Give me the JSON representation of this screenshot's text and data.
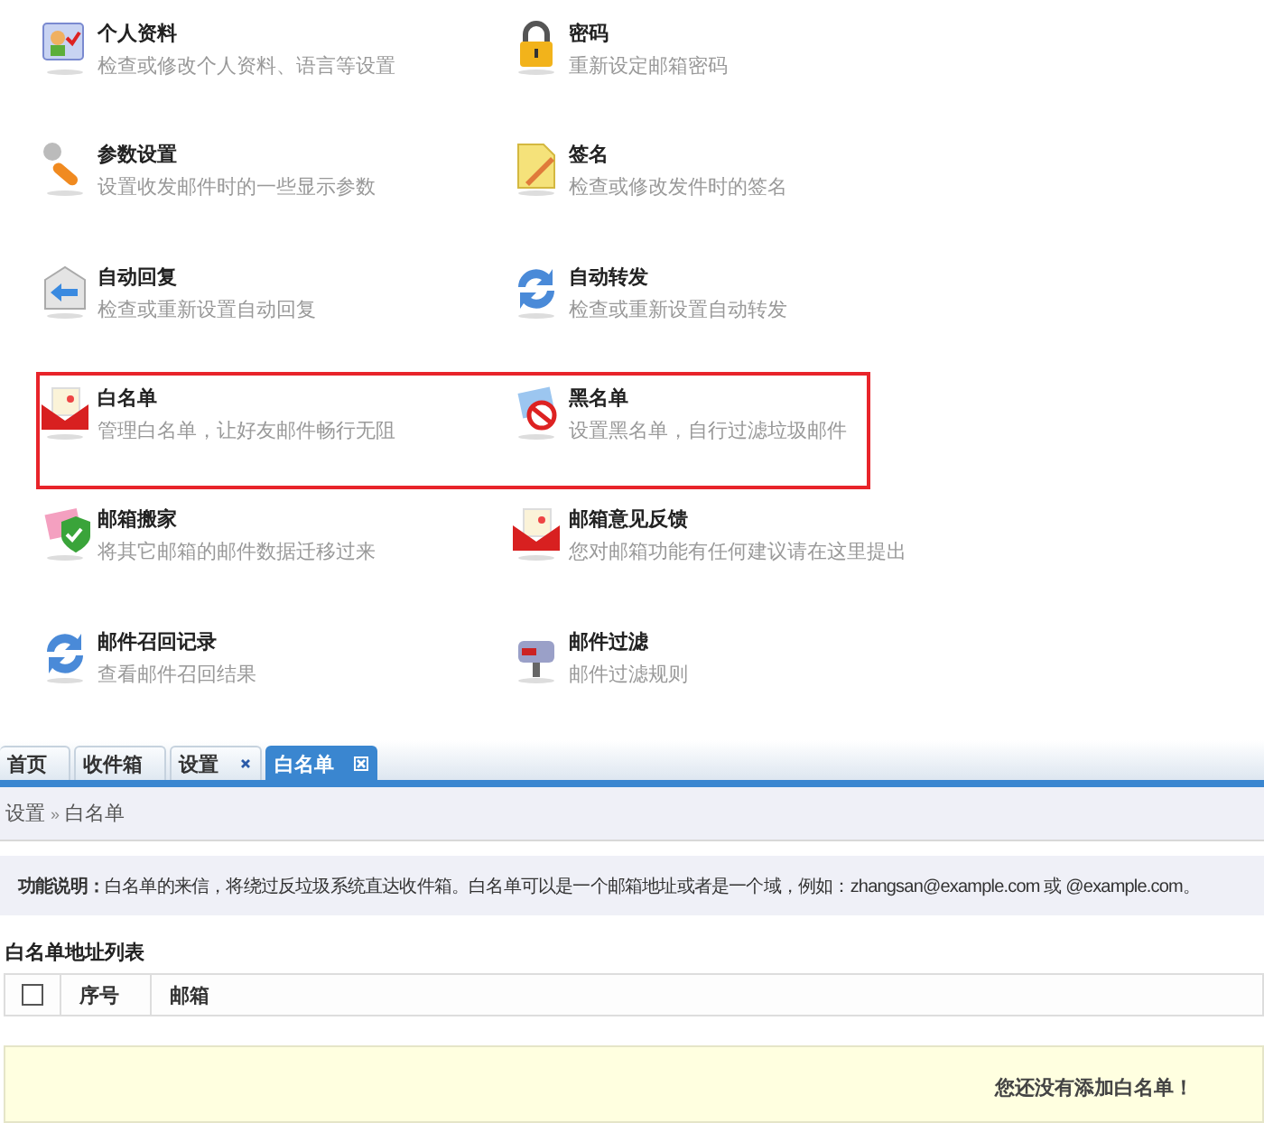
{
  "settings_rows": [
    {
      "highlighted": false,
      "items": [
        {
          "title": "个人资料",
          "description": "检查或修改个人资料、语言等设置"
        },
        {
          "title": "密码",
          "description": "重新设定邮箱密码"
        }
      ]
    },
    {
      "highlighted": false,
      "items": [
        {
          "title": "参数设置",
          "description": "设置收发邮件时的一些显示参数"
        },
        {
          "title": "签名",
          "description": "检查或修改发件时的签名"
        }
      ]
    },
    {
      "highlighted": false,
      "items": [
        {
          "title": "自动回复",
          "description": "检查或重新设置自动回复"
        },
        {
          "title": "自动转发",
          "description": "检查或重新设置自动转发"
        }
      ]
    },
    {
      "highlighted": true,
      "items": [
        {
          "title": "白名单",
          "description": "管理白名单，让好友邮件畅行无阻"
        },
        {
          "title": "黑名单",
          "description": "设置黑名单，自行过滤垃圾邮件"
        }
      ]
    },
    {
      "highlighted": false,
      "items": [
        {
          "title": "邮箱搬家",
          "description": "将其它邮箱的邮件数据迁移过来"
        },
        {
          "title": "邮箱意见反馈",
          "description": "您对邮箱功能有任何建议请在这里提出"
        }
      ]
    },
    {
      "highlighted": false,
      "items": [
        {
          "title": "邮件召回记录",
          "description": "查看邮件召回结果"
        },
        {
          "title": "邮件过滤",
          "description": "邮件过滤规则"
        }
      ]
    }
  ],
  "tabs": [
    {
      "label": "首页",
      "selected": false,
      "closable": false
    },
    {
      "label": "收件箱",
      "selected": false,
      "closable": false
    },
    {
      "label": "设置",
      "selected": false,
      "closable": true
    },
    {
      "label": "白名单",
      "selected": true,
      "closable": true
    }
  ],
  "breadcrumb": {
    "parent": "设置",
    "separator": "»",
    "current": "白名单"
  },
  "info": "**功能说明：**白名单的来信，将绕过反垃圾系统直达收件箱。白名单可以是一个邮箱地址或者是一个域，例如：zhangsan@example.com 或 @example.com。",
  "list_title": "白名单地址列表",
  "table": {
    "select_all_checked": false,
    "columns": [
      "序号",
      "邮箱"
    ]
  },
  "empty_message": "您还没有添加白名单！"
}
